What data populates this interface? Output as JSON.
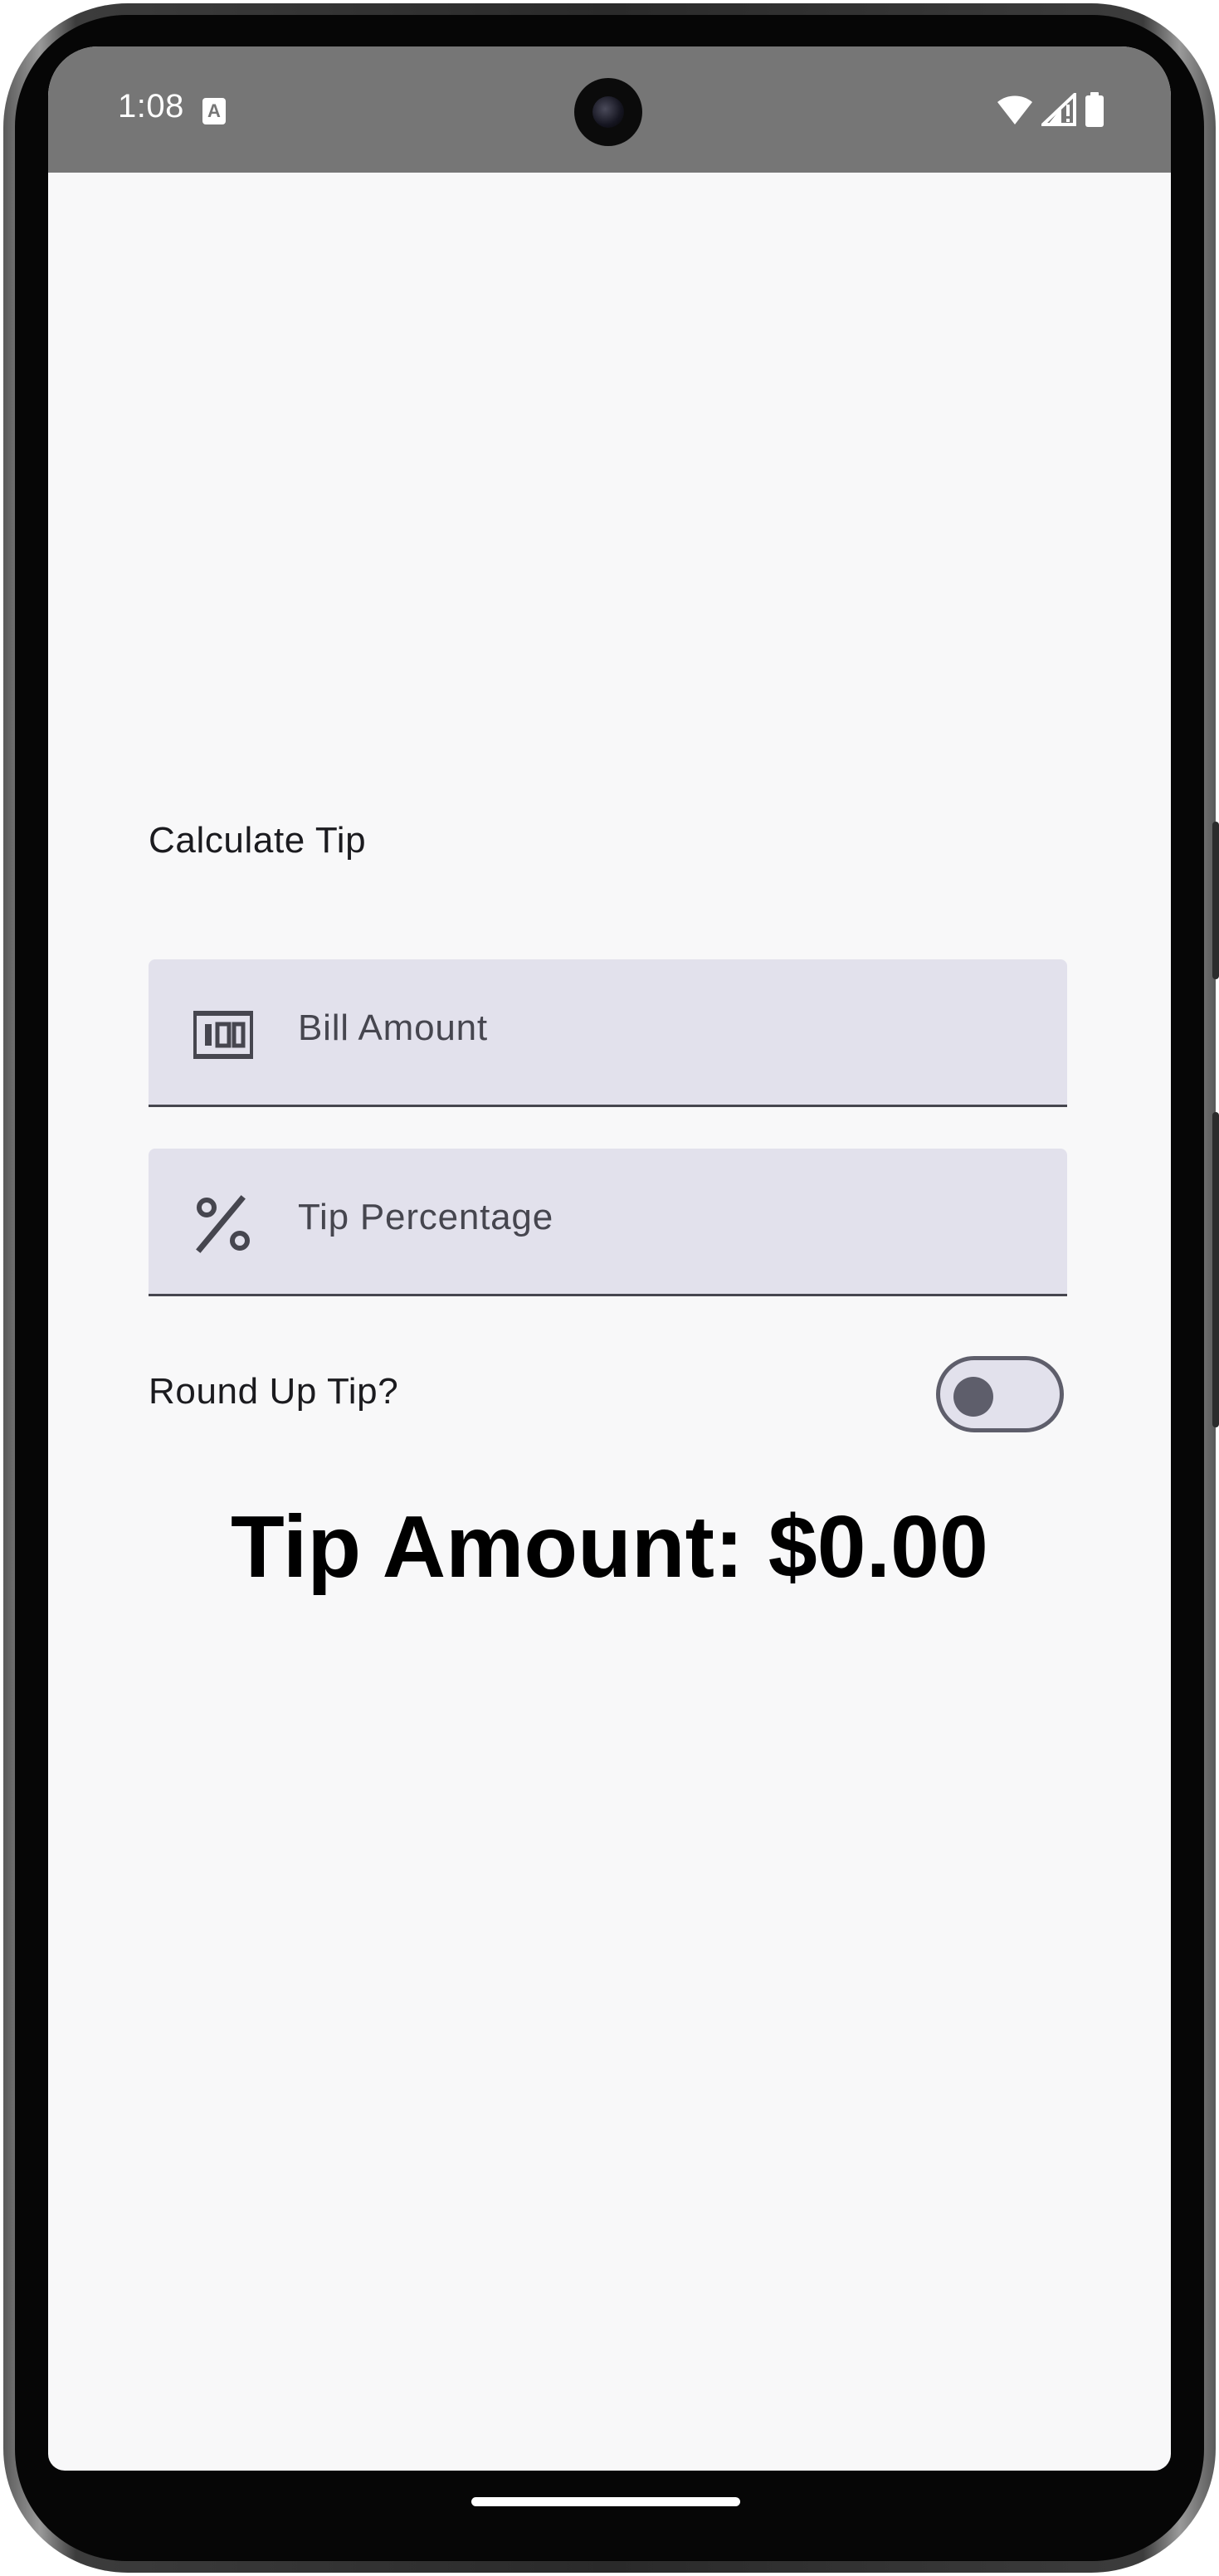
{
  "status_bar": {
    "time": "1:08",
    "notification_icon": "a-text-icon",
    "icons": [
      "wifi-icon",
      "signal-icon",
      "battery-icon"
    ]
  },
  "main": {
    "heading": "Calculate Tip",
    "bill_field": {
      "label": "Bill Amount",
      "icon": "money-icon"
    },
    "tip_field": {
      "label": "Tip Percentage",
      "icon": "percent-icon"
    },
    "round_up": {
      "label": "Round Up Tip?",
      "checked": false
    },
    "tip_amount": "Tip Amount: $0.00"
  },
  "colors": {
    "status_bar": "#767676",
    "background": "#f8f8f9",
    "field_fill": "#e2e1ec",
    "field_line": "#46464f",
    "switch_outline": "#5e5e6b"
  }
}
